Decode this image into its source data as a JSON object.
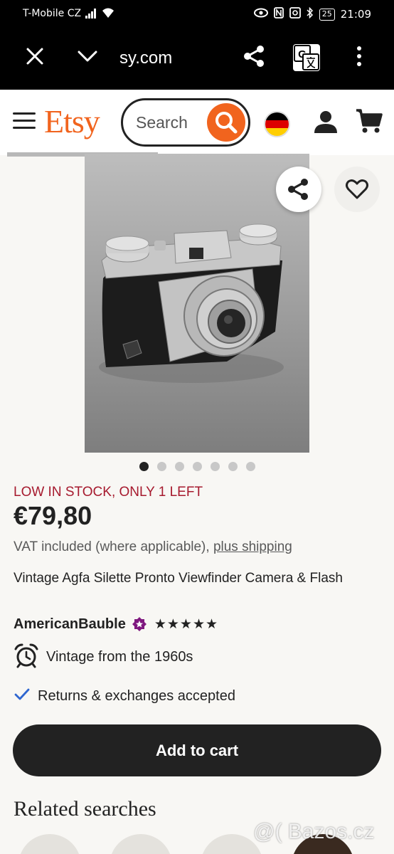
{
  "status_bar": {
    "carrier": "T-Mobile CZ",
    "battery": "25",
    "time": "21:09"
  },
  "browser": {
    "url": "sy.com"
  },
  "header": {
    "logo": "Etsy",
    "search_placeholder": "Search",
    "flag_colors": [
      "#000000",
      "#dd0000",
      "#ffce00"
    ],
    "brand_color": "#f1641e"
  },
  "product": {
    "image_count": 7,
    "active_image": 0,
    "stock_notice": "LOW IN STOCK, ONLY 1 LEFT",
    "price": "€79,80",
    "vat_text": "VAT included (where applicable), ",
    "shipping_link": "plus shipping",
    "title": "Vintage Agfa Silette Pronto Viewfinder Camera & Flash",
    "shop_name": "AmericanBauble",
    "rating_stars": "★★★★★",
    "rating": 5,
    "features": [
      {
        "icon": "alarm-clock-icon",
        "text": "Vintage from the 1960s"
      },
      {
        "icon": "checkmark-icon",
        "text": "Returns & exchanges accepted"
      }
    ],
    "add_to_cart_label": "Add to cart"
  },
  "related": {
    "heading": "Related searches"
  },
  "watermark": "@( Bazos.cz"
}
